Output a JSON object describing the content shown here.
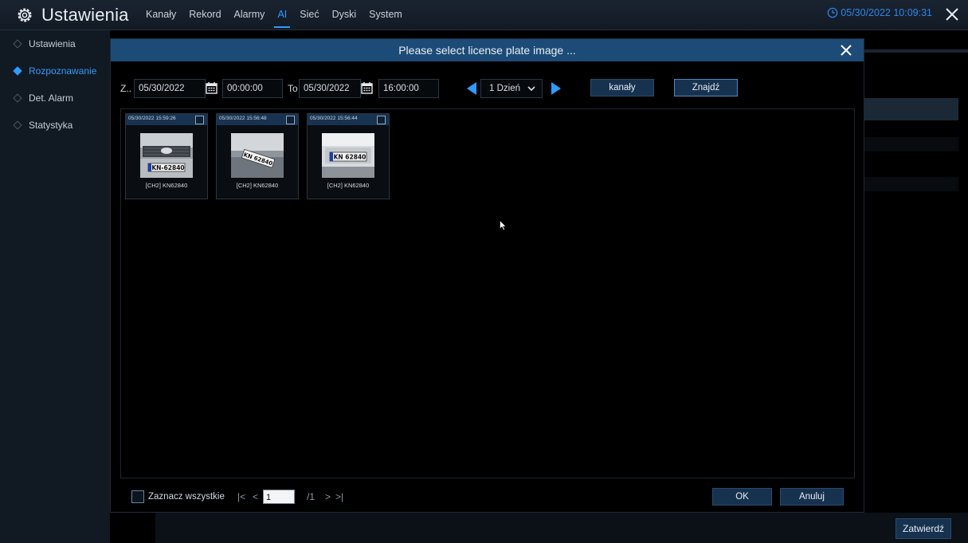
{
  "header": {
    "title": "Ustawienia",
    "tabs": [
      {
        "label": "Kanały",
        "active": false
      },
      {
        "label": "Rekord",
        "active": false
      },
      {
        "label": "Alarmy",
        "active": false
      },
      {
        "label": "AI",
        "active": true
      },
      {
        "label": "Sieć",
        "active": false
      },
      {
        "label": "Dyski",
        "active": false
      },
      {
        "label": "System",
        "active": false
      }
    ],
    "datetime": "05/30/2022 10:09:31"
  },
  "sidebar": {
    "items": [
      {
        "label": "Ustawienia",
        "active": false
      },
      {
        "label": "Rozpoznawanie",
        "active": true
      },
      {
        "label": "Det. Alarm",
        "active": false
      },
      {
        "label": "Statystyka",
        "active": false
      }
    ]
  },
  "modal": {
    "title": "Please select license plate image ...",
    "filter": {
      "from_label": "Z..",
      "from_date": "05/30/2022",
      "from_time": "00:00:00",
      "to_label": "To",
      "to_date": "05/30/2022",
      "to_time": "16:00:00",
      "period": "1 Dzień",
      "channels_button": "kanały",
      "search_button": "Znajdź"
    },
    "results": [
      {
        "timestamp": "05/30/2022 15:59:26",
        "caption": "[CH2] KN62840",
        "plate": "KN-62840",
        "checked": false
      },
      {
        "timestamp": "05/30/2022 15:56:48",
        "caption": "[CH2] KN62840",
        "plate": "KN 62840",
        "checked": false
      },
      {
        "timestamp": "05/30/2022 15:56:44",
        "caption": "[CH2] KN62840",
        "plate": "KN 62840",
        "checked": false
      }
    ],
    "footer": {
      "select_all_label": "Zaznacz wszystkie",
      "first_page": "|<",
      "prev_page": "<",
      "page_value": "1",
      "page_total": "/1",
      "next_page": ">",
      "last_page": ">|",
      "ok_button": "OK",
      "cancel_button": "Anuluj"
    }
  },
  "bottom": {
    "confirm_button": "Zatwierdź"
  },
  "colors": {
    "accent": "#2f9bff",
    "modal_header": "#1c4b77",
    "button_bg": "#17324f"
  }
}
